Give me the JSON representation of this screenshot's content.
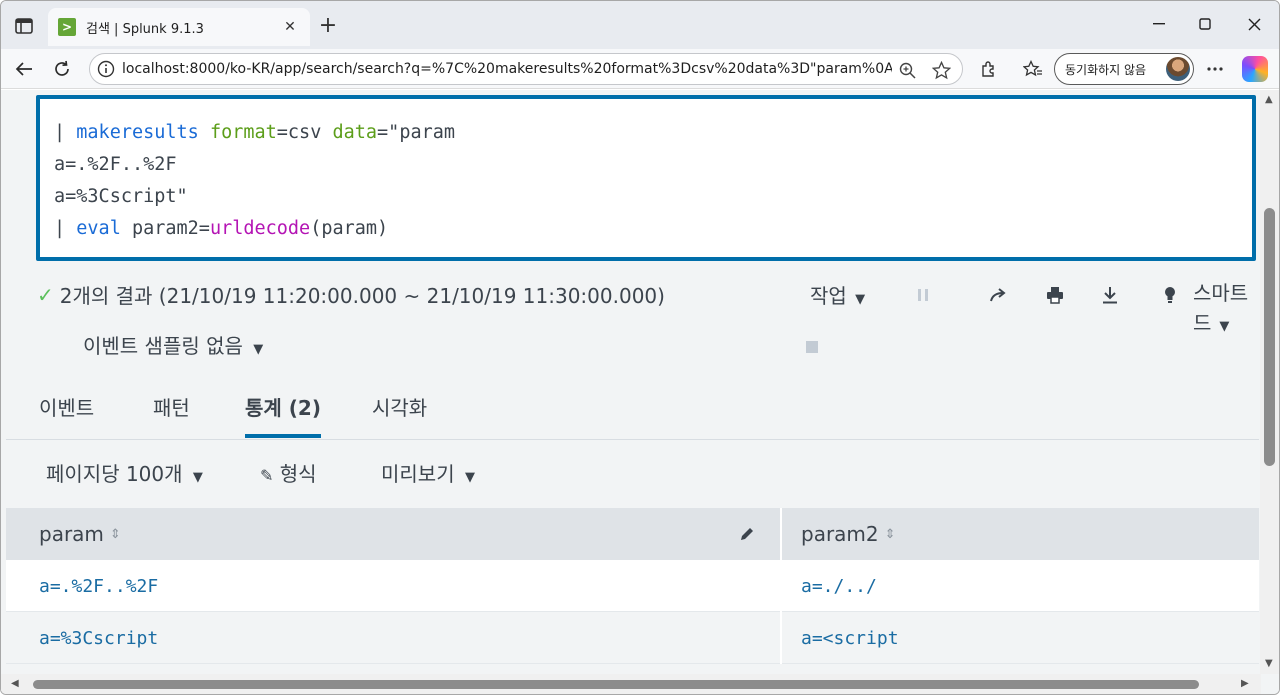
{
  "browser": {
    "tab_title": "검색 | Splunk 9.1.3",
    "tab_close": "✕",
    "new_tab": "+",
    "url": "localhost:8000/ko-KR/app/search/search?q=%7C%20makeresults%20format%3Dcsv%20data%3D\"param%0Aa%...",
    "profile_label": "동기화하지 않음",
    "icons": [
      "sidebar-icon",
      "back-icon",
      "reload-icon",
      "info-icon",
      "zoom-icon",
      "star-icon",
      "extensions-icon",
      "favorites-icon",
      "more-icon",
      "copilot-icon",
      "minimize-icon",
      "maximize-icon",
      "close-icon"
    ]
  },
  "search": {
    "line1": {
      "pipe": "| ",
      "cmd": "makeresults",
      "sp1": " ",
      "arg1": "format",
      "eq1": "=csv ",
      "arg2": "data",
      "rest": "=\"param"
    },
    "line2": "a=.%2F..%2F",
    "line3": "a=%3Cscript\"",
    "line4": {
      "pipe": "| ",
      "cmd": "eval",
      "mid": " param2=",
      "fn": "urldecode",
      "rest": "(param)"
    }
  },
  "results": {
    "status": "2개의 결과 (21/10/19 11:20:00.000 ~ 21/10/19 11:30:00.000)",
    "sampling": "이벤트 샘플링 없음",
    "job_menu": "작업",
    "smart_mode_line1": "스마트",
    "smart_mode_line2": "드"
  },
  "tabs": [
    {
      "label": "이벤트"
    },
    {
      "label": "패턴"
    },
    {
      "label": "통계 (2)",
      "active": true
    },
    {
      "label": "시각화"
    }
  ],
  "table_options": {
    "per_page": "페이지당 100개",
    "format": "형식",
    "preview": "미리보기"
  },
  "table": {
    "columns": [
      "param",
      "param2"
    ],
    "rows": [
      [
        "a=.%2F..%2F",
        "a=./../"
      ],
      [
        "a=%3Cscript",
        "a=<script"
      ]
    ]
  },
  "colors": {
    "accent": "#006eaa",
    "keyword_blue": "#1a6bd6",
    "keyword_green": "#5c9e1a",
    "keyword_purple": "#b414b4",
    "cell_text": "#1a6ca3",
    "success": "#5cc05c"
  }
}
